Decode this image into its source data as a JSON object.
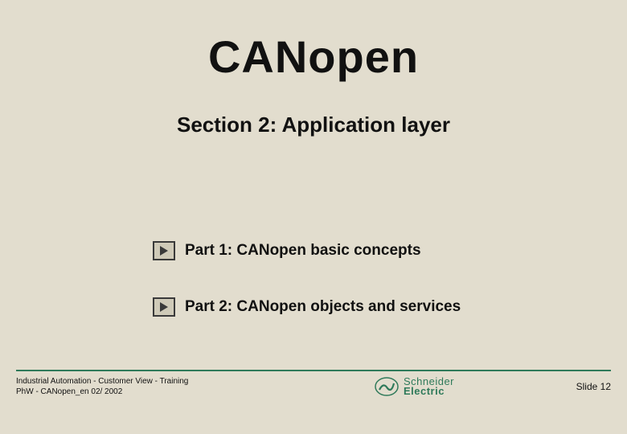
{
  "title": "CANopen",
  "subtitle": "Section 2: Application layer",
  "items": [
    {
      "label": "Part 1: CANopen basic concepts"
    },
    {
      "label": "Part 2: CANopen objects and services"
    }
  ],
  "footer": {
    "line1": "Industrial Automation - Customer View - Training",
    "line2": "PhW - CANopen_en  02/ 2002",
    "slide": "Slide 12"
  },
  "logo": {
    "top": "Schneider",
    "bottom": "Electric"
  }
}
